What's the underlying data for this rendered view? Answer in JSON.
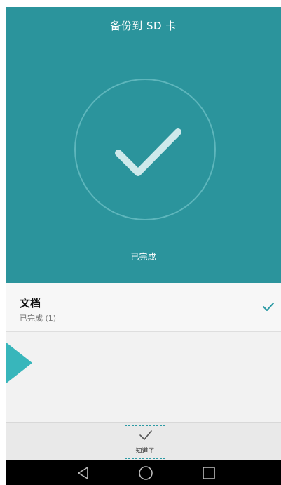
{
  "header": {
    "title": "备份到 SD 卡",
    "status": "已完成",
    "background_color": "#2b949c",
    "progress_fraction": 1.0,
    "icon": "checkmark-icon"
  },
  "list": {
    "items": [
      {
        "name": "文档",
        "status": "已完成 (1)",
        "icon": "check-icon",
        "accent_color": "#2b9aa4"
      }
    ]
  },
  "footer": {
    "got_it_label": "知道了",
    "got_it_icon": "check-icon"
  },
  "navbar": {
    "back_icon": "back-triangle-icon",
    "home_icon": "home-circle-icon",
    "recents_icon": "recents-square-icon"
  },
  "overlay": {
    "arrow_icon": "scroll-right-arrow-icon",
    "arrow_color": "#38b6bb"
  }
}
